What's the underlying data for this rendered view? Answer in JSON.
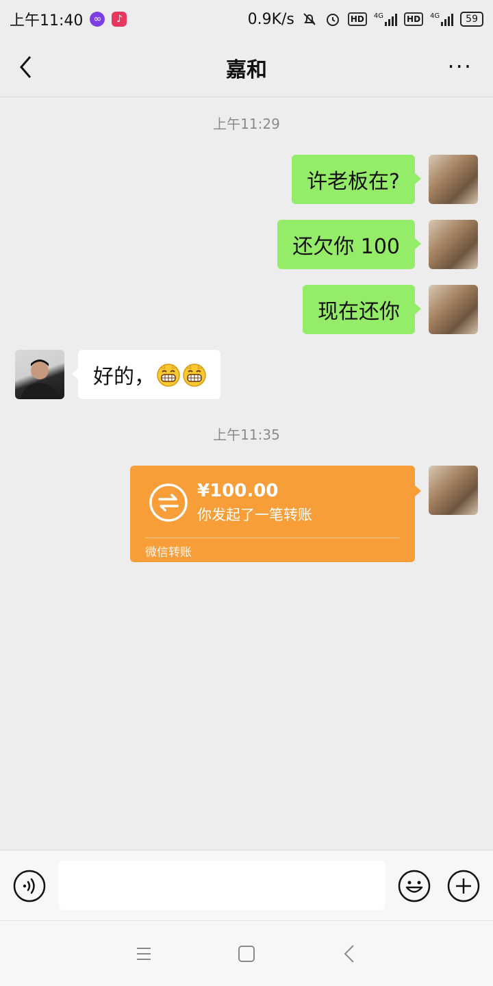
{
  "status_bar": {
    "time": "上午11:40",
    "network_speed": "0.9K/s",
    "sim1_badge": "HD",
    "sim1_net": "4G",
    "sim2_badge": "HD",
    "sim2_net": "4G",
    "battery": "59",
    "icons": [
      "link-app-icon",
      "tiktok-app-icon",
      "mute-icon",
      "alarm-icon",
      "signal-icon",
      "battery-icon"
    ]
  },
  "header": {
    "title": "嘉和",
    "back_icon": "chevron-left-icon",
    "more_label": "···"
  },
  "messages": {
    "time_1": "上午11:29",
    "msg_1": "许老板在?",
    "msg_2": "还欠你 100",
    "msg_3": "现在还你",
    "msg_4": "好的，",
    "msg_4_emoji": [
      "grinning-face-icon",
      "grinning-face-icon"
    ],
    "time_2": "上午11:35",
    "transfer": {
      "amount": "¥100.00",
      "note": "你发起了一笔转账",
      "footer": "微信转账",
      "color": "#f79e39"
    }
  },
  "input_bar": {
    "value": "",
    "voice_icon": "voice-icon",
    "emoji_icon": "smile-icon",
    "plus_icon": "plus-icon"
  },
  "colors": {
    "background": "#ededed",
    "my_bubble": "#95ec69",
    "their_bubble": "#ffffff",
    "timestamp": "#8a8a8a"
  }
}
